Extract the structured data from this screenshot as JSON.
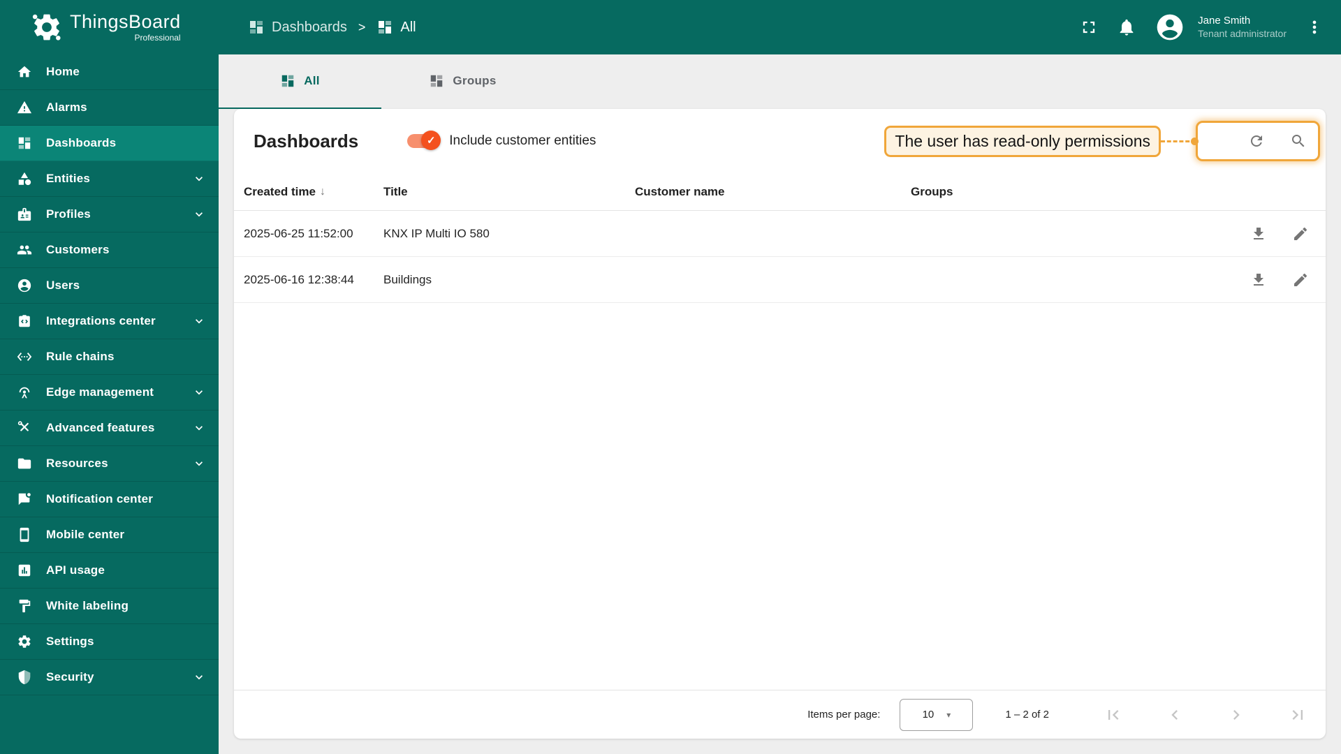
{
  "app": {
    "name": "ThingsBoard",
    "edition": "Professional"
  },
  "header": {
    "separator": ">",
    "breadcrumb": [
      {
        "label": "Dashboards",
        "icon": "dashboards-icon"
      },
      {
        "label": "All",
        "icon": "dashboards-icon"
      }
    ],
    "actions": [
      "fullscreen-icon",
      "bell-icon"
    ],
    "user": {
      "name": "Jane Smith",
      "role": "Tenant administrator",
      "avatar_icon": "person-circle-icon",
      "menu_icon": "kebab-icon"
    }
  },
  "sidebar": {
    "items": [
      {
        "label": "Home",
        "icon": "home",
        "expandable": false,
        "active": false
      },
      {
        "label": "Alarms",
        "icon": "warning-triangle",
        "expandable": false,
        "active": false
      },
      {
        "label": "Dashboards",
        "icon": "dashboards-grid",
        "expandable": false,
        "active": true
      },
      {
        "label": "Entities",
        "icon": "shapes",
        "expandable": true,
        "active": false
      },
      {
        "label": "Profiles",
        "icon": "badge",
        "expandable": true,
        "active": false
      },
      {
        "label": "Customers",
        "icon": "people",
        "expandable": false,
        "active": false
      },
      {
        "label": "Users",
        "icon": "person-circle",
        "expandable": false,
        "active": false
      },
      {
        "label": "Integrations center",
        "icon": "integration-box",
        "expandable": true,
        "active": false
      },
      {
        "label": "Rule chains",
        "icon": "ethernet-chevrons",
        "expandable": false,
        "active": false
      },
      {
        "label": "Edge management",
        "icon": "antenna",
        "expandable": true,
        "active": false
      },
      {
        "label": "Advanced features",
        "icon": "crossed-tools",
        "expandable": true,
        "active": false
      },
      {
        "label": "Resources",
        "icon": "folder",
        "expandable": true,
        "active": false
      },
      {
        "label": "Notification center",
        "icon": "message-dot",
        "expandable": false,
        "active": false
      },
      {
        "label": "Mobile center",
        "icon": "smartphone",
        "expandable": false,
        "active": false
      },
      {
        "label": "API usage",
        "icon": "bar-chart-box",
        "expandable": false,
        "active": false
      },
      {
        "label": "White labeling",
        "icon": "paint-roller",
        "expandable": false,
        "active": false
      },
      {
        "label": "Settings",
        "icon": "gear",
        "expandable": false,
        "active": false
      },
      {
        "label": "Security",
        "icon": "shield",
        "expandable": true,
        "active": false
      }
    ]
  },
  "tabs": [
    {
      "label": "All",
      "icon": "dashboards-icon",
      "active": true
    },
    {
      "label": "Groups",
      "icon": "dashboards-icon",
      "active": false
    }
  ],
  "content": {
    "title": "Dashboards",
    "toggle_label": "Include customer entities",
    "toggle_on": true,
    "annotation": {
      "text": "The user has read-only permissions"
    },
    "toolbar_icons": [
      "refresh-icon",
      "search-icon"
    ],
    "table": {
      "columns": [
        "Created time",
        "Title",
        "Customer name",
        "Groups"
      ],
      "sort_column": "Created time",
      "sort_direction": "desc",
      "sort_arrow": "↓",
      "rows": [
        {
          "created_time": "2025-06-25 11:52:00",
          "title": "KNX IP Multi IO 580",
          "customer_name": "",
          "groups": "",
          "actions": [
            "download-icon",
            "edit-icon"
          ]
        },
        {
          "created_time": "2025-06-16 12:38:44",
          "title": "Buildings",
          "customer_name": "",
          "groups": "",
          "actions": [
            "download-icon",
            "edit-icon"
          ]
        }
      ]
    },
    "pagination": {
      "items_per_page_label": "Items per page:",
      "items_per_page": "10",
      "caret": "▾",
      "range": "1 – 2 of 2",
      "nav_icons": [
        "first-page-icon",
        "prev-page-icon",
        "next-page-icon",
        "last-page-icon"
      ]
    }
  },
  "colors": {
    "primary_teal": "#066a60",
    "active_sidebar_item": "#0b8577",
    "accent_orange": "#f4511e",
    "toggle_track": "#f78f6d",
    "annotation_amber": "#f0a63a",
    "page_background": "#eeeeee",
    "icon_gray": "#757575",
    "disabled_gray": "#c5c5c5"
  }
}
